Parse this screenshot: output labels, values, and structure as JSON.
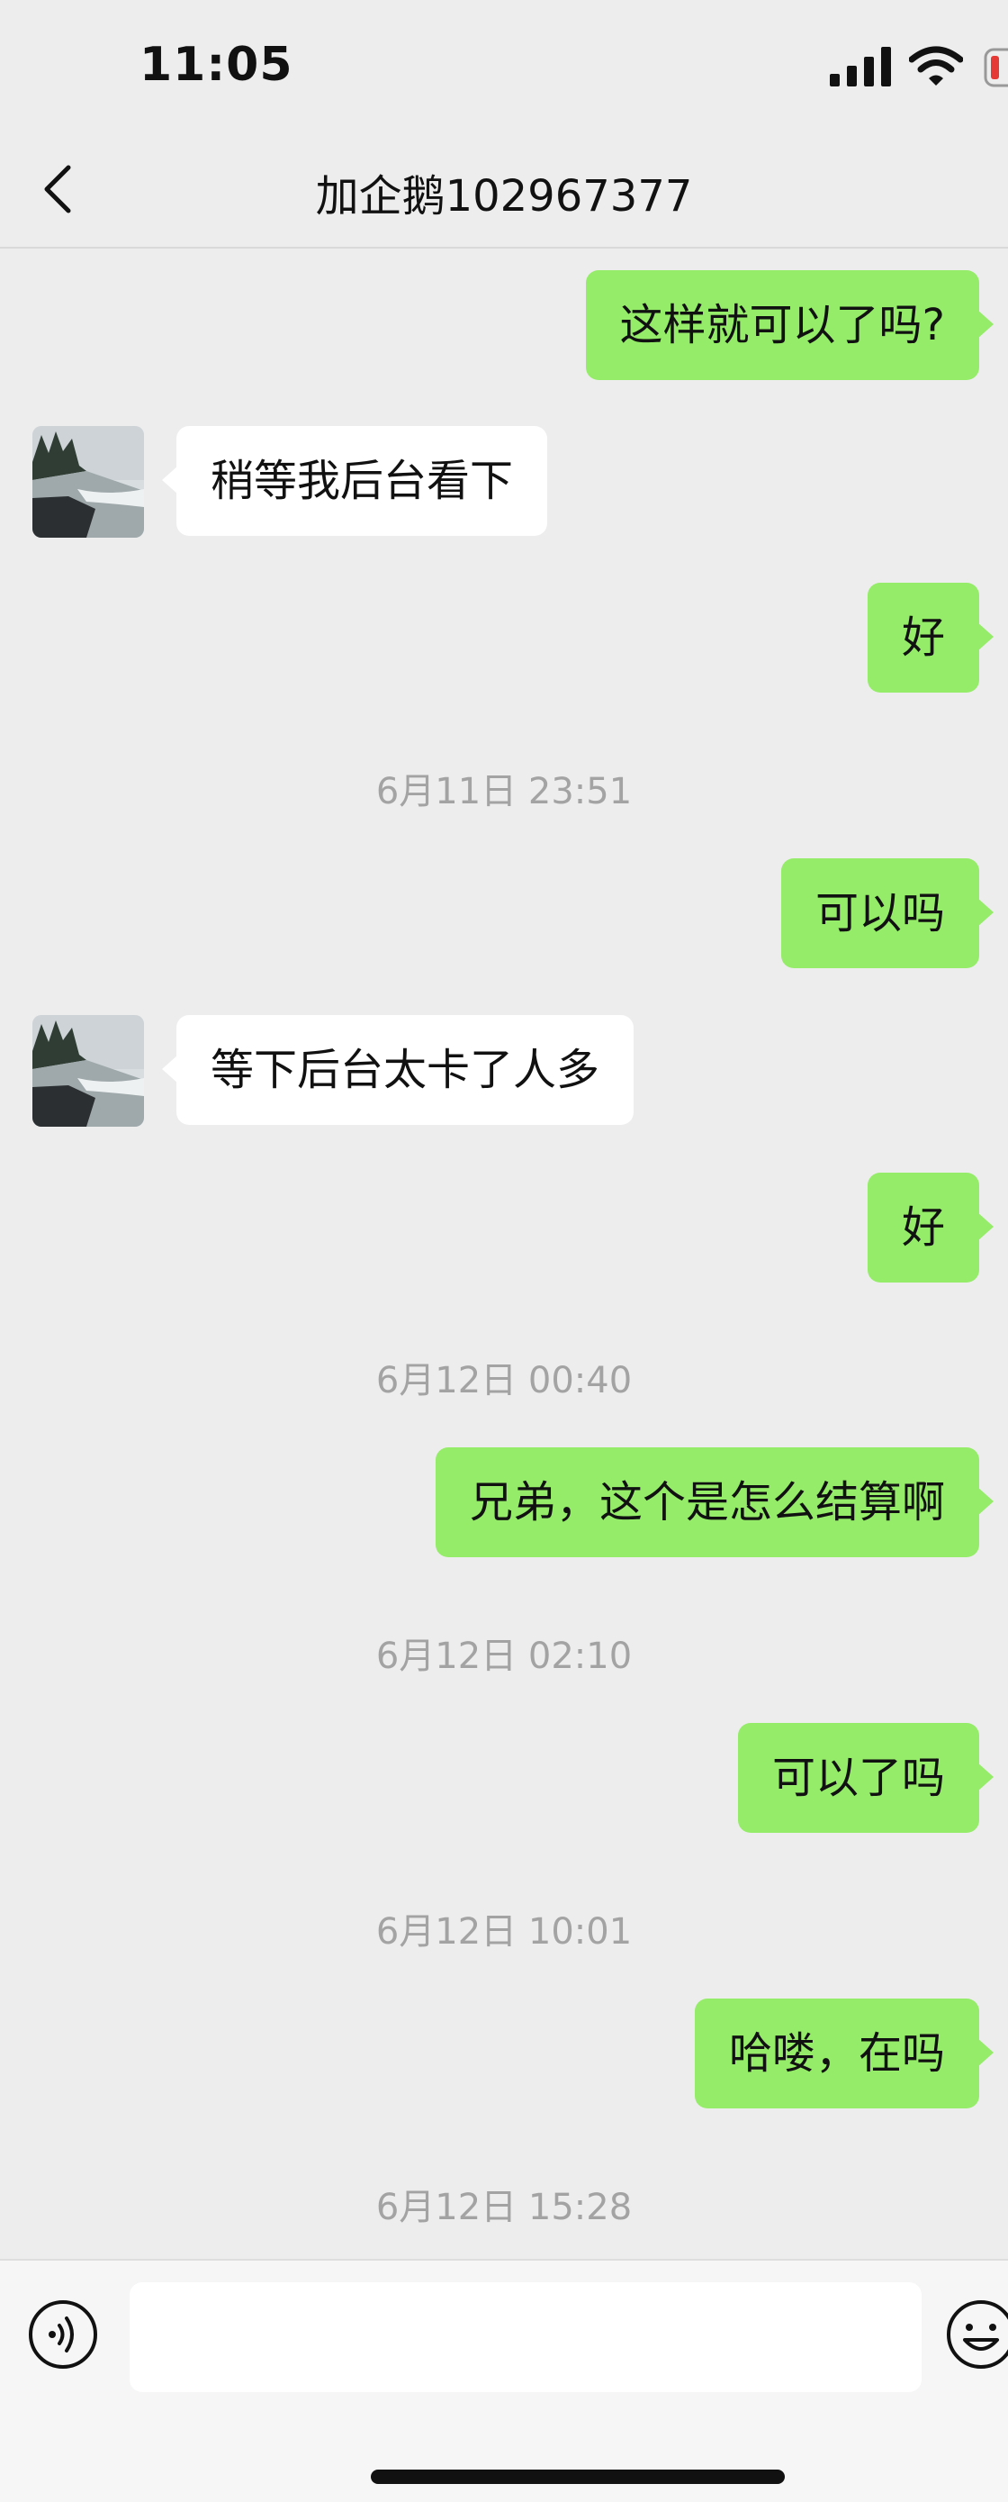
{
  "status_bar": {
    "time": "11:05"
  },
  "nav": {
    "title": "加企鹅102967377",
    "back_icon": "chevron-left-icon"
  },
  "messages": [
    {
      "type": "out",
      "text": "这样就可以了吗?"
    },
    {
      "type": "in",
      "text": "稍等我后台看下"
    },
    {
      "type": "out",
      "text": "好"
    },
    {
      "type": "time",
      "text": "6月11日 23:51"
    },
    {
      "type": "out",
      "text": "可以吗"
    },
    {
      "type": "in",
      "text": "等下后台太卡了人多"
    },
    {
      "type": "out",
      "text": "好"
    },
    {
      "type": "time",
      "text": "6月12日 00:40"
    },
    {
      "type": "out",
      "text": "兄弟，这个是怎么结算啊"
    },
    {
      "type": "time",
      "text": "6月12日 02:10"
    },
    {
      "type": "out",
      "text": "可以了吗"
    },
    {
      "type": "time",
      "text": "6月12日 10:01"
    },
    {
      "type": "out",
      "text": "哈喽，在吗"
    },
    {
      "type": "time",
      "text": "6月12日 15:28"
    }
  ],
  "input_bar": {
    "voice_icon": "voice-icon",
    "emoji_icon": "emoji-icon",
    "input_value": ""
  },
  "colors": {
    "background": "#ededed",
    "outgoing_bubble": "#95ec69",
    "incoming_bubble": "#ffffff",
    "timestamp_text": "#a3a3a3"
  }
}
